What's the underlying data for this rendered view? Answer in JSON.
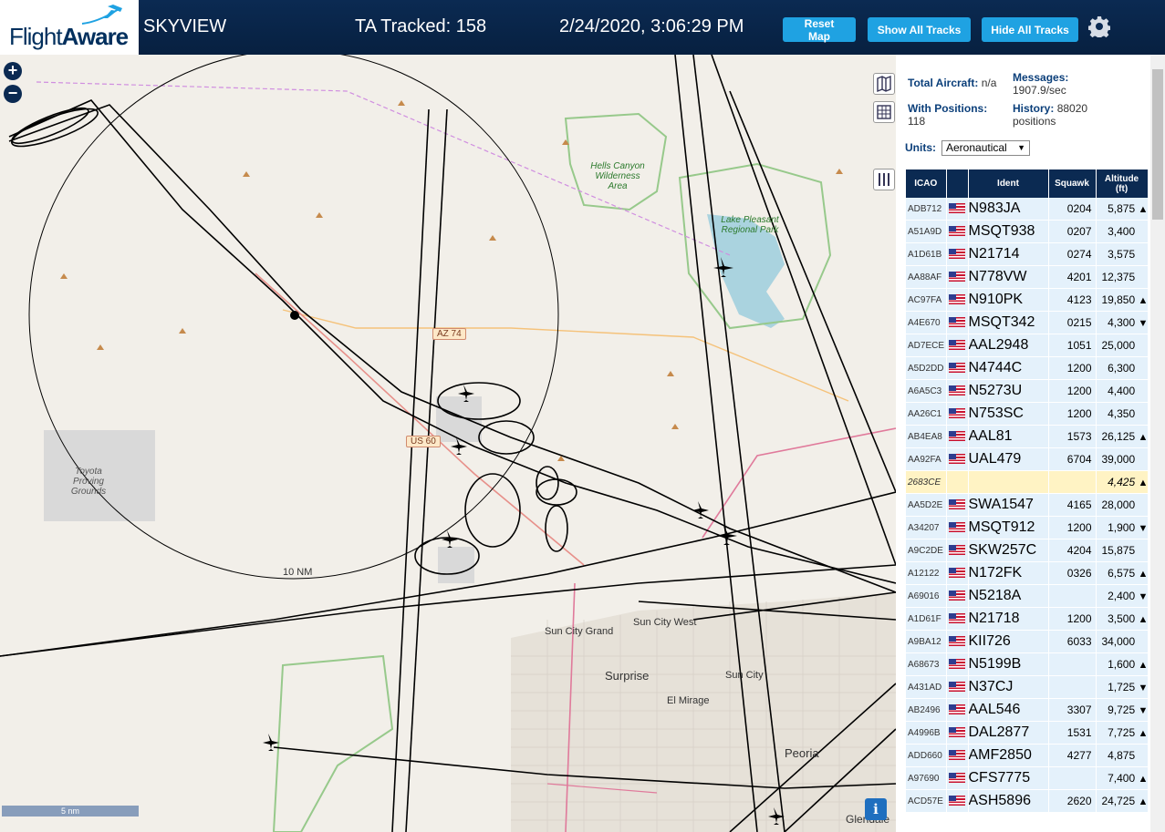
{
  "header": {
    "brand_light": "Flight",
    "brand_bold": "Aware",
    "title": "SKYVIEW",
    "tracked": "TA Tracked: 158",
    "datetime": "2/24/2020, 3:06:29 PM",
    "reset_label": "Reset Map",
    "show_label": "Show All Tracks",
    "hide_label": "Hide All Tracks",
    "gear_icon": "gear-icon"
  },
  "map": {
    "zoom_in": "+",
    "zoom_out": "−",
    "range_label": "10 NM",
    "scale_label": "5 nm",
    "info": "i",
    "places": {
      "hells_canyon": "Hells Canyon Wilderness Area",
      "lake_pleasant": "Lake Pleasant Regional Park",
      "toyota": "Toyota Proving Grounds",
      "az74": "AZ 74",
      "us60": "US 60",
      "sun_city_grand": "Sun City Grand",
      "sun_city_west": "Sun City West",
      "surprise": "Surprise",
      "sun_city": "Sun City",
      "el_mirage": "El Mirage",
      "peoria": "Peoria",
      "glendale": "Glendale"
    },
    "accent": "#1fa2e2",
    "track_color": "#000000"
  },
  "sidebar": {
    "total_label": "Total Aircraft:",
    "total_value": "n/a",
    "messages_label": "Messages:",
    "messages_value": "1907.9/sec",
    "positions_label": "With Positions:",
    "positions_value": "118",
    "history_label": "History:",
    "history_value": "88020",
    "history_unit": "positions",
    "units_label": "Units:",
    "units_value": "Aeronautical",
    "columns": {
      "icao": "ICAO",
      "ident": "Ident",
      "squawk": "Squawk",
      "altitude": "Altitude",
      "altitude_unit": "(ft)"
    },
    "rows": [
      {
        "icao": "ADB712",
        "ident": "N983JA",
        "squawk": "0204",
        "alt": "5,875",
        "trend": "▲"
      },
      {
        "icao": "A51A9D",
        "ident": "MSQT938",
        "squawk": "0207",
        "alt": "3,400",
        "trend": ""
      },
      {
        "icao": "A1D61B",
        "ident": "N21714",
        "squawk": "0274",
        "alt": "3,575",
        "trend": ""
      },
      {
        "icao": "AA88AF",
        "ident": "N778VW",
        "squawk": "4201",
        "alt": "12,375",
        "trend": ""
      },
      {
        "icao": "AC97FA",
        "ident": "N910PK",
        "squawk": "4123",
        "alt": "19,850",
        "trend": "▲"
      },
      {
        "icao": "A4E670",
        "ident": "MSQT342",
        "squawk": "0215",
        "alt": "4,300",
        "trend": "▼"
      },
      {
        "icao": "AD7ECE",
        "ident": "AAL2948",
        "squawk": "1051",
        "alt": "25,000",
        "trend": ""
      },
      {
        "icao": "A5D2DD",
        "ident": "N4744C",
        "squawk": "1200",
        "alt": "6,300",
        "trend": ""
      },
      {
        "icao": "A6A5C3",
        "ident": "N5273U",
        "squawk": "1200",
        "alt": "4,400",
        "trend": ""
      },
      {
        "icao": "AA26C1",
        "ident": "N753SC",
        "squawk": "1200",
        "alt": "4,350",
        "trend": ""
      },
      {
        "icao": "AB4EA8",
        "ident": "AAL81",
        "squawk": "1573",
        "alt": "26,125",
        "trend": "▲"
      },
      {
        "icao": "AA92FA",
        "ident": "UAL479",
        "squawk": "6704",
        "alt": "39,000",
        "trend": ""
      },
      {
        "icao": "2683CE",
        "ident": "",
        "squawk": "",
        "alt": "4,425",
        "trend": "▲",
        "selected": true
      },
      {
        "icao": "AA5D2E",
        "ident": "SWA1547",
        "squawk": "4165",
        "alt": "28,000",
        "trend": ""
      },
      {
        "icao": "A34207",
        "ident": "MSQT912",
        "squawk": "1200",
        "alt": "1,900",
        "trend": "▼"
      },
      {
        "icao": "A9C2DE",
        "ident": "SKW257C",
        "squawk": "4204",
        "alt": "15,875",
        "trend": ""
      },
      {
        "icao": "A12122",
        "ident": "N172FK",
        "squawk": "0326",
        "alt": "6,575",
        "trend": "▲"
      },
      {
        "icao": "A69016",
        "ident": "N5218A",
        "squawk": "",
        "alt": "2,400",
        "trend": "▼"
      },
      {
        "icao": "A1D61F",
        "ident": "N21718",
        "squawk": "1200",
        "alt": "3,500",
        "trend": "▲"
      },
      {
        "icao": "A9BA12",
        "ident": "KII726",
        "squawk": "6033",
        "alt": "34,000",
        "trend": ""
      },
      {
        "icao": "A68673",
        "ident": "N5199B",
        "squawk": "",
        "alt": "1,600",
        "trend": "▲"
      },
      {
        "icao": "A431AD",
        "ident": "N37CJ",
        "squawk": "",
        "alt": "1,725",
        "trend": "▼"
      },
      {
        "icao": "AB2496",
        "ident": "AAL546",
        "squawk": "3307",
        "alt": "9,725",
        "trend": "▼"
      },
      {
        "icao": "A4996B",
        "ident": "DAL2877",
        "squawk": "1531",
        "alt": "7,725",
        "trend": "▲"
      },
      {
        "icao": "ADD660",
        "ident": "AMF2850",
        "squawk": "4277",
        "alt": "4,875",
        "trend": ""
      },
      {
        "icao": "A97690",
        "ident": "CFS7775",
        "squawk": "",
        "alt": "7,400",
        "trend": "▲"
      },
      {
        "icao": "ACD57E",
        "ident": "ASH5896",
        "squawk": "2620",
        "alt": "24,725",
        "trend": "▲"
      }
    ]
  }
}
